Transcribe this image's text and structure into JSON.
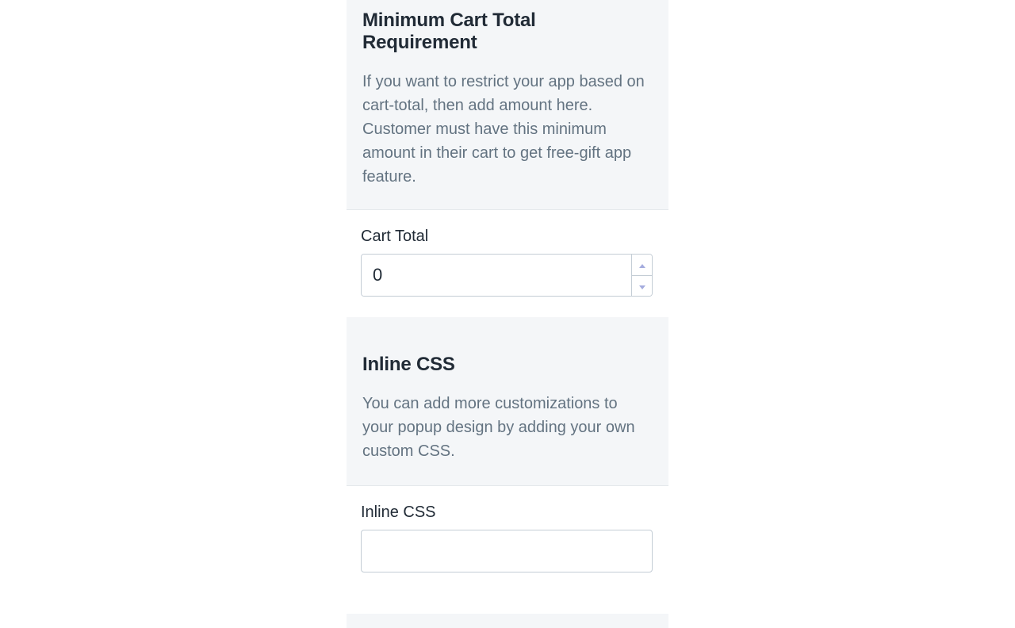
{
  "sections": {
    "minCart": {
      "title": "Minimum Cart Total Requirement",
      "desc": "If you want to restrict your app based on cart-total, then add amount here. Customer must have this minimum amount in their cart to get free-gift app feature.",
      "fieldLabel": "Cart Total",
      "value": "0"
    },
    "inlineCss": {
      "title": "Inline CSS",
      "desc": "You can add more customizations to your popup design by adding your own custom CSS.",
      "fieldLabel": "Inline CSS",
      "value": ""
    }
  }
}
